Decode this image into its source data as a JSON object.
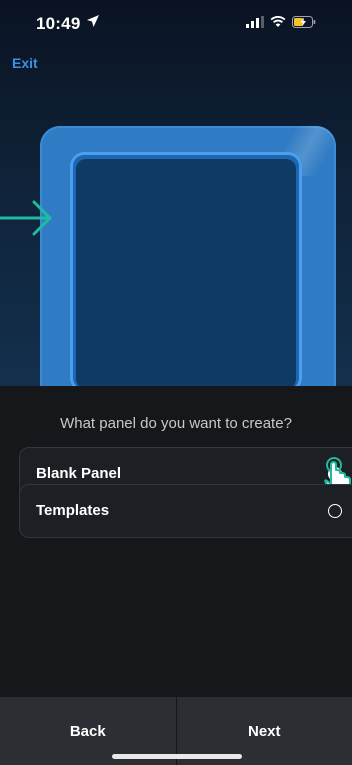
{
  "status": {
    "time": "10:49"
  },
  "header": {
    "exit_label": "Exit"
  },
  "content": {
    "question": "What panel do you want to create?"
  },
  "options": [
    {
      "label": "Blank Panel",
      "selected": true
    },
    {
      "label": "Templates",
      "selected": false
    }
  ],
  "nav": {
    "back_label": "Back",
    "next_label": "Next"
  },
  "colors": {
    "accent": "#3b8fe4",
    "arrow": "#1ebc9c",
    "panel": "#2f7bc4"
  }
}
